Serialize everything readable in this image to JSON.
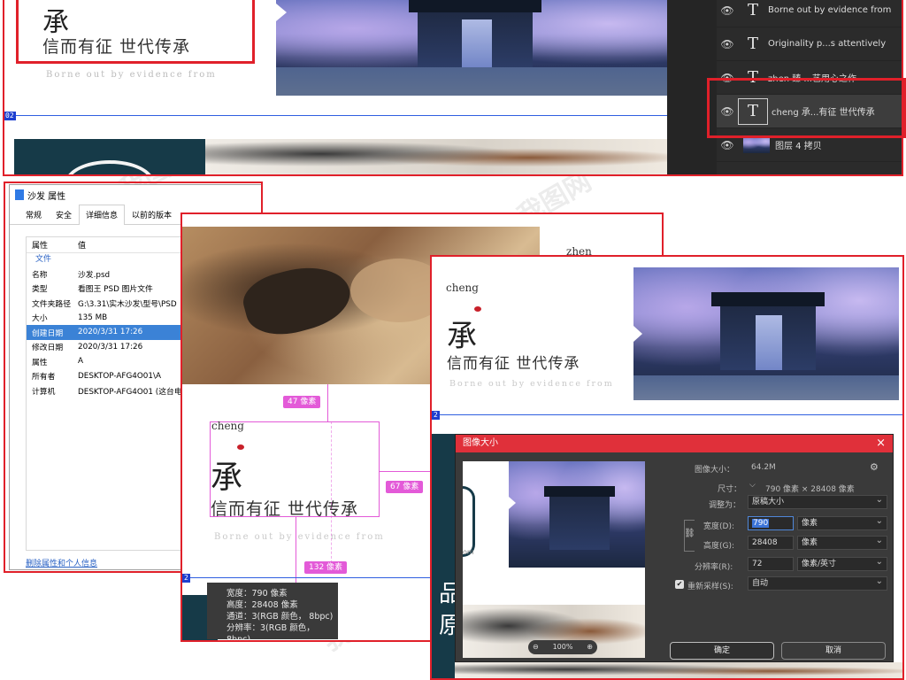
{
  "design": {
    "char_big": "承",
    "tagline": "信而有征 世代传承",
    "subtitle": "Borne out by evidence from",
    "cheng": "cheng",
    "zhen": "zhen",
    "blue_tag_1": "02",
    "blue_tag_2": "2",
    "blue_tag_3": "2"
  },
  "layers_panel": {
    "rows": [
      {
        "label": "Borne out by evidence from",
        "icon": "text-layer-icon"
      },
      {
        "label": "Originality p...s attentively",
        "icon": "text-layer-icon"
      },
      {
        "label": "zhen 臻 ...艺用心之作",
        "icon": "text-layer-icon"
      },
      {
        "label": "cheng 承...有征 世代传承",
        "icon": "text-layer-icon"
      },
      {
        "label": "图层 4 拷贝",
        "icon": "image-layer-thumb"
      }
    ]
  },
  "properties_dialog": {
    "title": "沙发 属性",
    "tabs": [
      "常规",
      "安全",
      "详细信息",
      "以前的版本"
    ],
    "active_tab": "详细信息",
    "columns": [
      "属性",
      "值"
    ],
    "group": "文件",
    "rows": [
      {
        "key": "名称",
        "value": "沙发.psd"
      },
      {
        "key": "类型",
        "value": "看图王 PSD 图片文件"
      },
      {
        "key": "文件夹路径",
        "value": "G:\\3.31\\实木沙发\\型号\\PSD"
      },
      {
        "key": "大小",
        "value": "135 MB"
      },
      {
        "key": "创建日期",
        "value": "2020/3/31 17:26"
      },
      {
        "key": "修改日期",
        "value": "2020/3/31 17:26"
      },
      {
        "key": "属性",
        "value": "A"
      },
      {
        "key": "所有者",
        "value": "DESKTOP-AFG4O01\\A"
      },
      {
        "key": "计算机",
        "value": "DESKTOP-AFG4O01 (这台电"
      }
    ],
    "selected_row": 4,
    "remove_link": "删除属性和个人信息"
  },
  "measure": {
    "label_47": "47 像素",
    "label_67": "67 像素",
    "label_132": "132 像素",
    "info_lines": [
      "宽度：790 像素",
      "高度：28408 像素",
      "通道：3(RGB 颜色， 8bpc)",
      "分辨率：3(RGB 颜色， 8bpc)"
    ]
  },
  "image_size_dialog": {
    "title": "图像大小",
    "close": "×",
    "image_size_label": "图像大小：",
    "image_size_value": "64.2M",
    "dimension_label": "尺寸：",
    "dimension_value": "790 像素 × 28408 像素",
    "fit_label": "调整为：",
    "fit_value": "原稿大小",
    "width_label": "宽度(D):",
    "width_value": "790",
    "width_unit": "像素",
    "height_label": "高度(G):",
    "height_value": "28408",
    "height_unit": "像素",
    "res_label": "分辨率(R):",
    "res_value": "72",
    "res_unit": "像素/英寸",
    "resample_label": "重新采样(S):",
    "resample_value": "自动",
    "resample_checked": true,
    "zoom": "100%",
    "ok": "确定",
    "cancel": "取消"
  },
  "preview_text": {
    "pin_char_1": "品",
    "pin_char_2": "原",
    "om": "om"
  }
}
